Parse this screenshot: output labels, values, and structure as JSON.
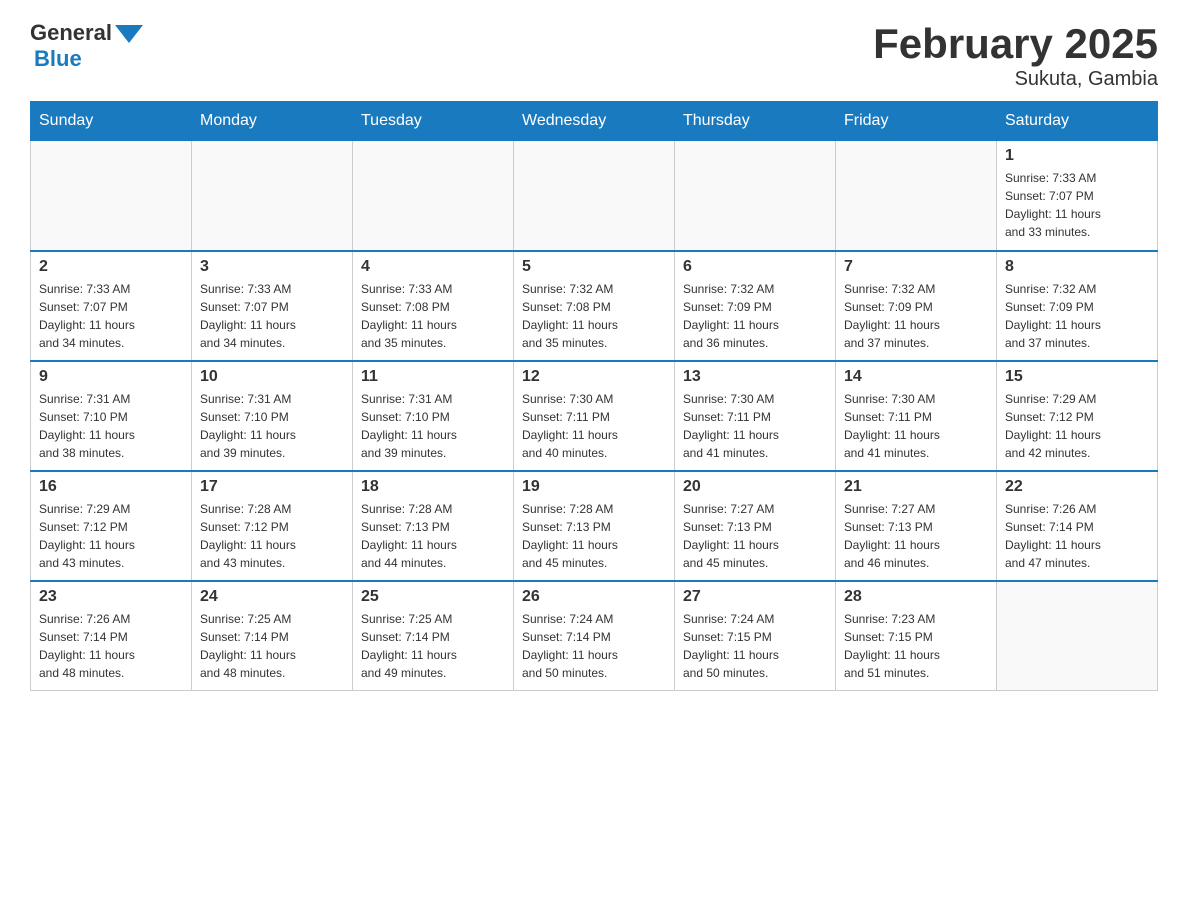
{
  "header": {
    "logo_general": "General",
    "logo_blue": "Blue",
    "month_title": "February 2025",
    "location": "Sukuta, Gambia"
  },
  "weekdays": [
    "Sunday",
    "Monday",
    "Tuesday",
    "Wednesday",
    "Thursday",
    "Friday",
    "Saturday"
  ],
  "weeks": [
    [
      {
        "day": "",
        "info": ""
      },
      {
        "day": "",
        "info": ""
      },
      {
        "day": "",
        "info": ""
      },
      {
        "day": "",
        "info": ""
      },
      {
        "day": "",
        "info": ""
      },
      {
        "day": "",
        "info": ""
      },
      {
        "day": "1",
        "info": "Sunrise: 7:33 AM\nSunset: 7:07 PM\nDaylight: 11 hours\nand 33 minutes."
      }
    ],
    [
      {
        "day": "2",
        "info": "Sunrise: 7:33 AM\nSunset: 7:07 PM\nDaylight: 11 hours\nand 34 minutes."
      },
      {
        "day": "3",
        "info": "Sunrise: 7:33 AM\nSunset: 7:07 PM\nDaylight: 11 hours\nand 34 minutes."
      },
      {
        "day": "4",
        "info": "Sunrise: 7:33 AM\nSunset: 7:08 PM\nDaylight: 11 hours\nand 35 minutes."
      },
      {
        "day": "5",
        "info": "Sunrise: 7:32 AM\nSunset: 7:08 PM\nDaylight: 11 hours\nand 35 minutes."
      },
      {
        "day": "6",
        "info": "Sunrise: 7:32 AM\nSunset: 7:09 PM\nDaylight: 11 hours\nand 36 minutes."
      },
      {
        "day": "7",
        "info": "Sunrise: 7:32 AM\nSunset: 7:09 PM\nDaylight: 11 hours\nand 37 minutes."
      },
      {
        "day": "8",
        "info": "Sunrise: 7:32 AM\nSunset: 7:09 PM\nDaylight: 11 hours\nand 37 minutes."
      }
    ],
    [
      {
        "day": "9",
        "info": "Sunrise: 7:31 AM\nSunset: 7:10 PM\nDaylight: 11 hours\nand 38 minutes."
      },
      {
        "day": "10",
        "info": "Sunrise: 7:31 AM\nSunset: 7:10 PM\nDaylight: 11 hours\nand 39 minutes."
      },
      {
        "day": "11",
        "info": "Sunrise: 7:31 AM\nSunset: 7:10 PM\nDaylight: 11 hours\nand 39 minutes."
      },
      {
        "day": "12",
        "info": "Sunrise: 7:30 AM\nSunset: 7:11 PM\nDaylight: 11 hours\nand 40 minutes."
      },
      {
        "day": "13",
        "info": "Sunrise: 7:30 AM\nSunset: 7:11 PM\nDaylight: 11 hours\nand 41 minutes."
      },
      {
        "day": "14",
        "info": "Sunrise: 7:30 AM\nSunset: 7:11 PM\nDaylight: 11 hours\nand 41 minutes."
      },
      {
        "day": "15",
        "info": "Sunrise: 7:29 AM\nSunset: 7:12 PM\nDaylight: 11 hours\nand 42 minutes."
      }
    ],
    [
      {
        "day": "16",
        "info": "Sunrise: 7:29 AM\nSunset: 7:12 PM\nDaylight: 11 hours\nand 43 minutes."
      },
      {
        "day": "17",
        "info": "Sunrise: 7:28 AM\nSunset: 7:12 PM\nDaylight: 11 hours\nand 43 minutes."
      },
      {
        "day": "18",
        "info": "Sunrise: 7:28 AM\nSunset: 7:13 PM\nDaylight: 11 hours\nand 44 minutes."
      },
      {
        "day": "19",
        "info": "Sunrise: 7:28 AM\nSunset: 7:13 PM\nDaylight: 11 hours\nand 45 minutes."
      },
      {
        "day": "20",
        "info": "Sunrise: 7:27 AM\nSunset: 7:13 PM\nDaylight: 11 hours\nand 45 minutes."
      },
      {
        "day": "21",
        "info": "Sunrise: 7:27 AM\nSunset: 7:13 PM\nDaylight: 11 hours\nand 46 minutes."
      },
      {
        "day": "22",
        "info": "Sunrise: 7:26 AM\nSunset: 7:14 PM\nDaylight: 11 hours\nand 47 minutes."
      }
    ],
    [
      {
        "day": "23",
        "info": "Sunrise: 7:26 AM\nSunset: 7:14 PM\nDaylight: 11 hours\nand 48 minutes."
      },
      {
        "day": "24",
        "info": "Sunrise: 7:25 AM\nSunset: 7:14 PM\nDaylight: 11 hours\nand 48 minutes."
      },
      {
        "day": "25",
        "info": "Sunrise: 7:25 AM\nSunset: 7:14 PM\nDaylight: 11 hours\nand 49 minutes."
      },
      {
        "day": "26",
        "info": "Sunrise: 7:24 AM\nSunset: 7:14 PM\nDaylight: 11 hours\nand 50 minutes."
      },
      {
        "day": "27",
        "info": "Sunrise: 7:24 AM\nSunset: 7:15 PM\nDaylight: 11 hours\nand 50 minutes."
      },
      {
        "day": "28",
        "info": "Sunrise: 7:23 AM\nSunset: 7:15 PM\nDaylight: 11 hours\nand 51 minutes."
      },
      {
        "day": "",
        "info": ""
      }
    ]
  ]
}
